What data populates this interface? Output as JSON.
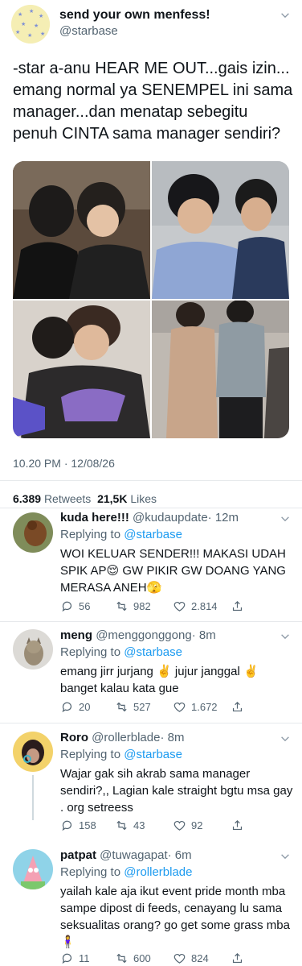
{
  "main_tweet": {
    "display_name": "send your own menfess!",
    "handle": "@starbase",
    "text": "-star  a-anu HEAR ME OUT...gais izin... emang normal ya SENEMPEL ini sama manager...dan menatap sebegitu penuh CINTA sama manager sendiri?",
    "timestamp": "10.20 PM · 12/08/26",
    "retweets_count": "6.389",
    "retweets_label": "Retweets",
    "likes_count": "21,5K",
    "likes_label": "Likes"
  },
  "replies": [
    {
      "display_name": "kuda here!!!",
      "handle": "@kudaupdate",
      "time": "· 12m",
      "replying_label": "Replying to",
      "replying_to": "@starbase",
      "text": "WOI KELUAR SENDER!!! MAKASI UDAH SPIK AP😌 GW PIKIR GW DOANG YANG MERASA ANEH🫣",
      "replies": "56",
      "retweets": "982",
      "likes": "2.814"
    },
    {
      "display_name": "meng",
      "handle": "@menggonggong",
      "time": "· 8m",
      "replying_label": "Replying to",
      "replying_to": "@starbase",
      "text": "emang jirr jurjang ✌️ jujur janggal ✌️ banget kalau kata gue",
      "replies": "20",
      "retweets": "527",
      "likes": "1.672"
    },
    {
      "display_name": "Roro",
      "handle": "@rollerblade",
      "time": "· 8m",
      "replying_label": "Replying to",
      "replying_to": "@starbase",
      "text": "Wajar gak sih akrab sama manager sendiri?,, Lagian kale straight bgtu msa gay . org setreess",
      "replies": "158",
      "retweets": "43",
      "likes": "92"
    },
    {
      "display_name": "patpat",
      "handle": "@tuwagapat",
      "time": "· 6m",
      "replying_label": "Replying to",
      "replying_to": "@rollerblade",
      "text": "yailah kale aja ikut event pride month mba sampe dipost di feeds, cenayang lu sama seksualitas orang? go get some grass mba 🧍‍♀️",
      "replies": "11",
      "retweets": "600",
      "likes": "824"
    }
  ],
  "icons": {
    "reply": "reply-icon",
    "retweet": "retweet-icon",
    "like": "heart-icon",
    "share": "share-icon",
    "more": "chevron-down-icon"
  },
  "colors": {
    "text": "#0f1419",
    "secondary": "#536471",
    "link": "#1d9bf0",
    "divider": "#e6e9ec"
  }
}
